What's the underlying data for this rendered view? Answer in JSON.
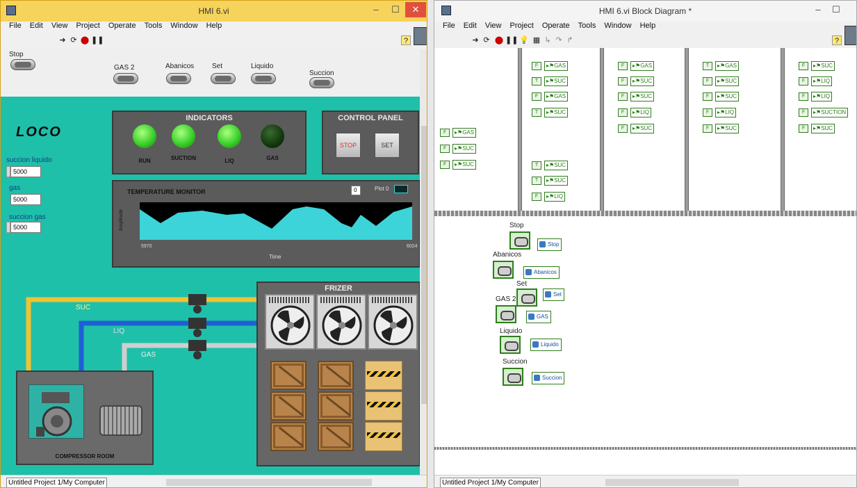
{
  "left_window": {
    "title": "HMI 6.vi",
    "menu": [
      "File",
      "Edit",
      "View",
      "Project",
      "Operate",
      "Tools",
      "Window",
      "Help"
    ],
    "controls": {
      "stop_label": "Stop",
      "gas2_label": "GAS 2",
      "abanicos_label": "Abanicos",
      "set_label": "Set",
      "liquido_label": "Liquido",
      "succion_label": "Succion"
    },
    "logo": "LOCO",
    "indicators": {
      "title": "INDICATORS",
      "leds": [
        {
          "label": "RUN",
          "state": "on"
        },
        {
          "label": "SUCTION",
          "state": "on"
        },
        {
          "label": "LIQ",
          "state": "on"
        },
        {
          "label": "GAS",
          "state": "off"
        }
      ]
    },
    "control_panel": {
      "title": "CONTROL PANEL",
      "stop_button": "STOP",
      "set_button": "SET"
    },
    "numeric_inputs": [
      {
        "label": "succion liquido",
        "value": "5000"
      },
      {
        "label": "gas",
        "value": "5000"
      },
      {
        "label": "succion gas",
        "value": "5000"
      }
    ],
    "temperature_monitor": {
      "title": "TEMPERATURE MONITOR",
      "value_box": "0",
      "plot_label": "Plot 0",
      "y_axis_label": "Amplitude",
      "x_axis_label": "Time",
      "x_start": "5970",
      "x_end": "6024"
    },
    "pipes": {
      "suc_label": "SUC",
      "liq_label": "LIQ",
      "gas_label": "GAS"
    },
    "frizer_title": "FRIZER",
    "compressor_room_title": "COMPRESSOR ROOM",
    "status": "Untitled Project 1/My Computer"
  },
  "right_window": {
    "title": "HMI 6.vi Block Diagram *",
    "menu": [
      "File",
      "Edit",
      "View",
      "Project",
      "Operate",
      "Tools",
      "Window",
      "Help"
    ],
    "frame_columns": [
      {
        "terms": [
          {
            "bool": "F",
            "label": "▸⚑GAS"
          },
          {
            "bool": "F",
            "label": "▸⚑SUC"
          },
          {
            "bool": "F",
            "label": "▸⚑SUC"
          }
        ]
      },
      {
        "terms": [
          {
            "bool": "F",
            "label": "▸⚑GAS"
          },
          {
            "bool": "T",
            "label": "▸⚑SUC"
          },
          {
            "bool": "F",
            "label": "▸⚑GAS"
          },
          {
            "bool": "T",
            "label": "▸⚑SUC"
          },
          {
            "bool": "T",
            "label": "▸⚑SUC"
          },
          {
            "bool": "T",
            "label": "▸⚑SUC"
          },
          {
            "bool": "F",
            "label": "▸⚑LIQ"
          }
        ]
      },
      {
        "terms": [
          {
            "bool": "F",
            "label": "▸⚑GAS"
          },
          {
            "bool": "F",
            "label": "▸⚑SUC"
          },
          {
            "bool": "F",
            "label": "▸⚑SUC"
          },
          {
            "bool": "F",
            "label": "▸⚑LIQ"
          },
          {
            "bool": "F",
            "label": "▸⚑SUC"
          }
        ]
      },
      {
        "terms": [
          {
            "bool": "T",
            "label": "▸⚑GAS"
          },
          {
            "bool": "F",
            "label": "▸⚑SUC"
          },
          {
            "bool": "F",
            "label": "▸⚑SUC"
          },
          {
            "bool": "F",
            "label": "▸⚑LIQ"
          },
          {
            "bool": "F",
            "label": "▸⚑SUC"
          }
        ]
      },
      {
        "terms": [
          {
            "bool": "F",
            "label": "▸⚑SUC"
          },
          {
            "bool": "F",
            "label": "▸⚑LIQ"
          },
          {
            "bool": "F",
            "label": "▸⚑LIQ"
          },
          {
            "bool": "F",
            "label": "▸⚑SUCTION"
          },
          {
            "bool": "F",
            "label": "▸⚑SUC"
          }
        ]
      }
    ],
    "controls": [
      {
        "caption": "Stop",
        "node": "Stop"
      },
      {
        "caption": "Abanicos",
        "node": "Abanicos"
      },
      {
        "caption": "Set",
        "node": "Set"
      },
      {
        "caption": "GAS 2",
        "node": "GAS"
      },
      {
        "caption": "Liquido",
        "node": "Liquido"
      },
      {
        "caption": "Succion",
        "node": "Succion"
      }
    ],
    "status": "Untitled Project 1/My Computer"
  },
  "colors": {
    "panel_bg": "#1ec0a9",
    "led_on": "#3ad12a",
    "pipe_suc": "#f1c232",
    "pipe_liq": "#1f5fd6",
    "pipe_gas": "#cfcfcf",
    "chart_fill": "#3cd4d8"
  }
}
